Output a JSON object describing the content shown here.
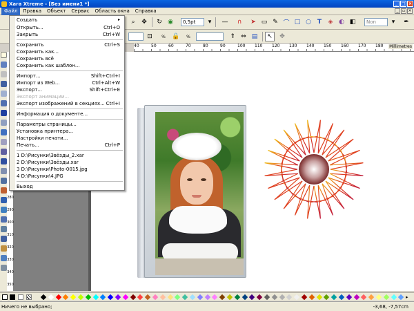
{
  "window": {
    "title": "Xara Xtreme - [Без имени1 *]"
  },
  "menubar": {
    "items": [
      {
        "label": "Файл",
        "active": true
      },
      {
        "label": "Правка"
      },
      {
        "label": "Объект"
      },
      {
        "label": "Сервис"
      },
      {
        "label": "Область окна"
      },
      {
        "label": "Справка"
      }
    ]
  },
  "file_menu": {
    "items": [
      {
        "label": "Создать",
        "shortcut": "",
        "submenu": true
      },
      {
        "label": "Открыть...",
        "shortcut": "Ctrl+O"
      },
      {
        "label": "Закрыть",
        "shortcut": "Ctrl+W"
      },
      {
        "label": "Сохранить",
        "shortcut": "Ctrl+S"
      },
      {
        "label": "Сохранить как...",
        "shortcut": ""
      },
      {
        "label": "Сохранить всё",
        "shortcut": ""
      },
      {
        "label": "Сохранить как шаблон...",
        "shortcut": ""
      },
      {
        "label": "Импорт...",
        "shortcut": "Shift+Ctrl+I"
      },
      {
        "label": "Импорт из Web...",
        "shortcut": "Ctrl+Alt+W"
      },
      {
        "label": "Экспорт...",
        "shortcut": "Shift+Ctrl+E"
      },
      {
        "label": "Экспорт анимации...",
        "shortcut": "",
        "disabled": true
      },
      {
        "label": "Экспорт изображений в секциях...",
        "shortcut": "Ctrl+I"
      },
      {
        "label": "Информация о документе...",
        "shortcut": ""
      },
      {
        "label": "Параметры страницы...",
        "shortcut": ""
      },
      {
        "label": "Установка принтера...",
        "shortcut": ""
      },
      {
        "label": "Настройки печати...",
        "shortcut": ""
      },
      {
        "label": "Печать...",
        "shortcut": "Ctrl+P"
      },
      {
        "label": "1 D:\\Рисунки\\Звёзды_2.xar",
        "shortcut": ""
      },
      {
        "label": "2 D:\\Рисунки\\Звёзды.xar",
        "shortcut": ""
      },
      {
        "label": "3 D:\\Рисунки\\Photo-0015.jpg",
        "shortcut": ""
      },
      {
        "label": "4 D:\\Рисунки\\4.JPG",
        "shortcut": ""
      },
      {
        "label": "Выход",
        "shortcut": ""
      }
    ]
  },
  "toolbar": {
    "line_width": "0,5pt",
    "line_name": "Non"
  },
  "ruler": {
    "unit": "Millimetres",
    "top_ticks": [
      "40",
      "50",
      "60",
      "70",
      "80",
      "90",
      "100",
      "110",
      "120",
      "130",
      "140",
      "150",
      "160",
      "170",
      "180"
    ],
    "left_ticks": [
      "280",
      "290",
      "300",
      "310",
      "320",
      "330",
      "340",
      "350",
      "360"
    ]
  },
  "status": {
    "text": "Ничего не выбрано;",
    "coords": "-3,68, -7,57cm"
  },
  "palette": [
    "#000000",
    "#ffffff",
    "#ff0000",
    "#ff8000",
    "#ffff00",
    "#c0ff00",
    "#00c000",
    "#00ffff",
    "#0080ff",
    "#0000ff",
    "#8000ff",
    "#ff00ff",
    "#800000",
    "#ff4040",
    "#c06020",
    "#ff80c0",
    "#ffc0a0",
    "#ffe080",
    "#80ff80",
    "#40c0a0",
    "#a0e0ff",
    "#8080ff",
    "#c080ff",
    "#ff80ff",
    "#804000",
    "#c0c000",
    "#008040",
    "#004080",
    "#400080",
    "#800040",
    "#606060",
    "#909090",
    "#b0b0b0",
    "#d0d0d0",
    "#f0f0f0",
    "#a00000",
    "#e06000",
    "#e0e000",
    "#60a000",
    "#00a0a0",
    "#0060c0",
    "#6000c0",
    "#c000c0",
    "#ff6060",
    "#ffa040",
    "#ffff80",
    "#a0ff60",
    "#60ffff",
    "#60a0ff"
  ]
}
